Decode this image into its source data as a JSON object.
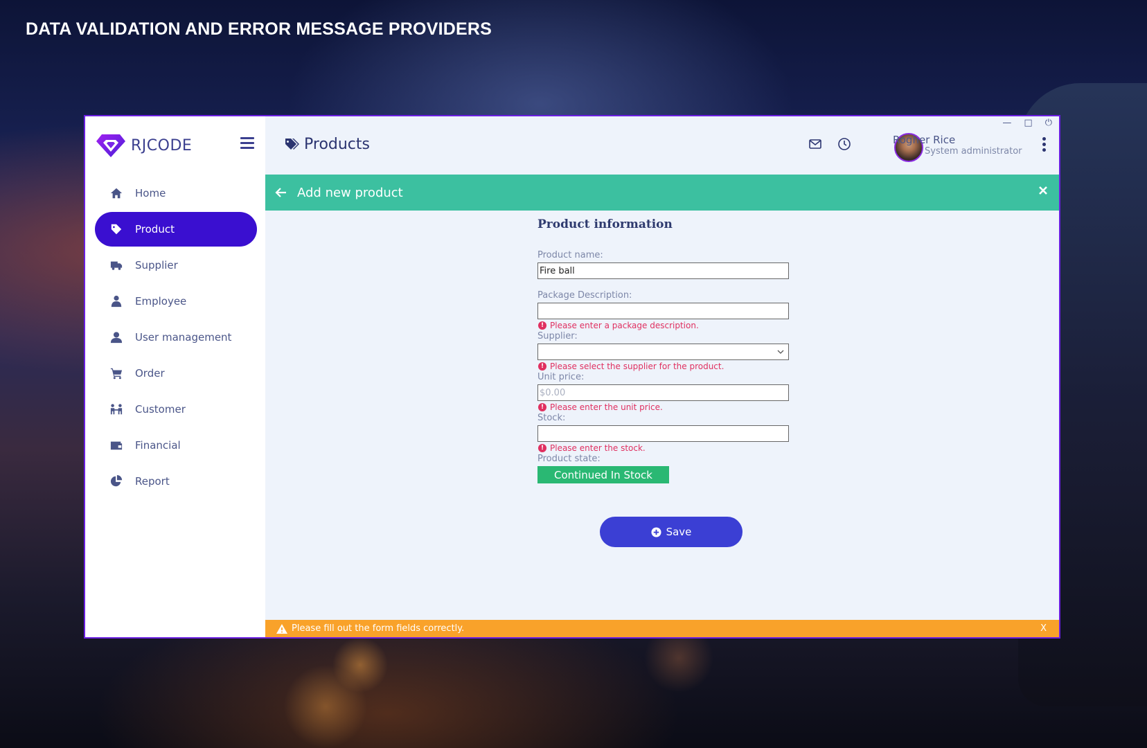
{
  "banner": {
    "text": "DATA VALIDATION AND ERROR MESSAGE PROVIDERS"
  },
  "app": {
    "logo_text": "RJCODE",
    "colors": {
      "accent": "#3a0fd0",
      "subheader": "#3cc0a0",
      "error": "#e03060",
      "warning_bar": "#f9a22a",
      "state_green": "#2ab873",
      "save": "#3b3fd4"
    }
  },
  "sidebar": {
    "items": [
      {
        "label": "Home",
        "icon": "home-icon",
        "active": false
      },
      {
        "label": "Product",
        "icon": "tag-icon",
        "active": true
      },
      {
        "label": "Supplier",
        "icon": "truck-icon",
        "active": false
      },
      {
        "label": "Employee",
        "icon": "employee-icon",
        "active": false
      },
      {
        "label": "User management",
        "icon": "user-icon",
        "active": false
      },
      {
        "label": "Order",
        "icon": "cart-icon",
        "active": false
      },
      {
        "label": "Customer",
        "icon": "customers-icon",
        "active": false
      },
      {
        "label": "Financial",
        "icon": "wallet-icon",
        "active": false
      },
      {
        "label": "Report",
        "icon": "pie-chart-icon",
        "active": false
      }
    ]
  },
  "header": {
    "title": "Products",
    "user_name": "Rogher Rice",
    "user_role": "System administrator"
  },
  "subheader": {
    "title": "Add new product"
  },
  "form": {
    "title": "Product information",
    "product_name": {
      "label": "Product name:",
      "value": "Fire ball"
    },
    "package_description": {
      "label": "Package Description:",
      "value": "",
      "error": "Please enter a package description."
    },
    "supplier": {
      "label": "Supplier:",
      "value": "",
      "error": "Please select the supplier for the product."
    },
    "unit_price": {
      "label": "Unit price:",
      "placeholder": "$0.00",
      "error": "Please enter the unit price."
    },
    "stock": {
      "label": "Stock:",
      "value": "",
      "error": "Please enter the stock."
    },
    "product_state": {
      "label": "Product state:",
      "value": "Continued In Stock"
    },
    "save_label": "Save"
  },
  "footer": {
    "message": "Please fill out the form fields correctly.",
    "close": "X"
  }
}
